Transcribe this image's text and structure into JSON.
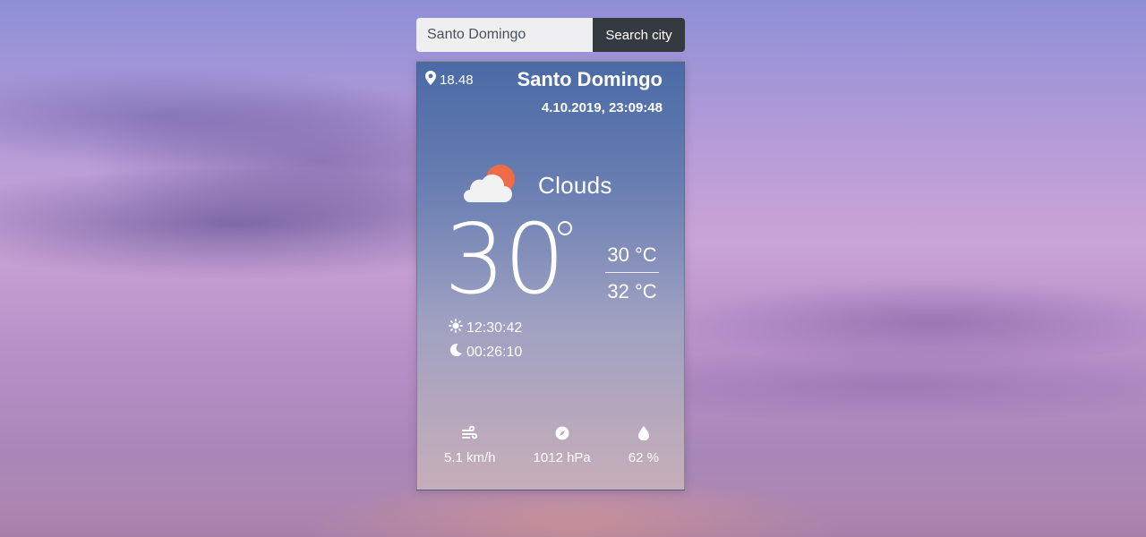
{
  "search": {
    "value": "Santo Domingo",
    "button_label": "Search city"
  },
  "weather": {
    "coordinate": "18.48",
    "city": "Santo Domingo",
    "datetime": "4.10.2019, 23:09:48",
    "condition": "Clouds",
    "temperature": "30",
    "temp_max": "30 °C",
    "temp_min": "32 °C",
    "sunrise": "12:30:42",
    "sunset": "00:26:10",
    "wind": "5.1 km/h",
    "pressure": "1012 hPa",
    "humidity": "62 %"
  },
  "icons": {
    "location": "map-pin-icon",
    "condition": "cloud-sun-icon",
    "sunrise": "sun-icon",
    "sunset": "moon-icon",
    "wind": "wind-icon",
    "pressure": "compass-icon",
    "humidity": "water-drop-icon"
  },
  "colors": {
    "search_button": "#343a40",
    "search_input": "#efeff2",
    "sun": "#ef6c47",
    "cloud": "#f2f2f2"
  }
}
